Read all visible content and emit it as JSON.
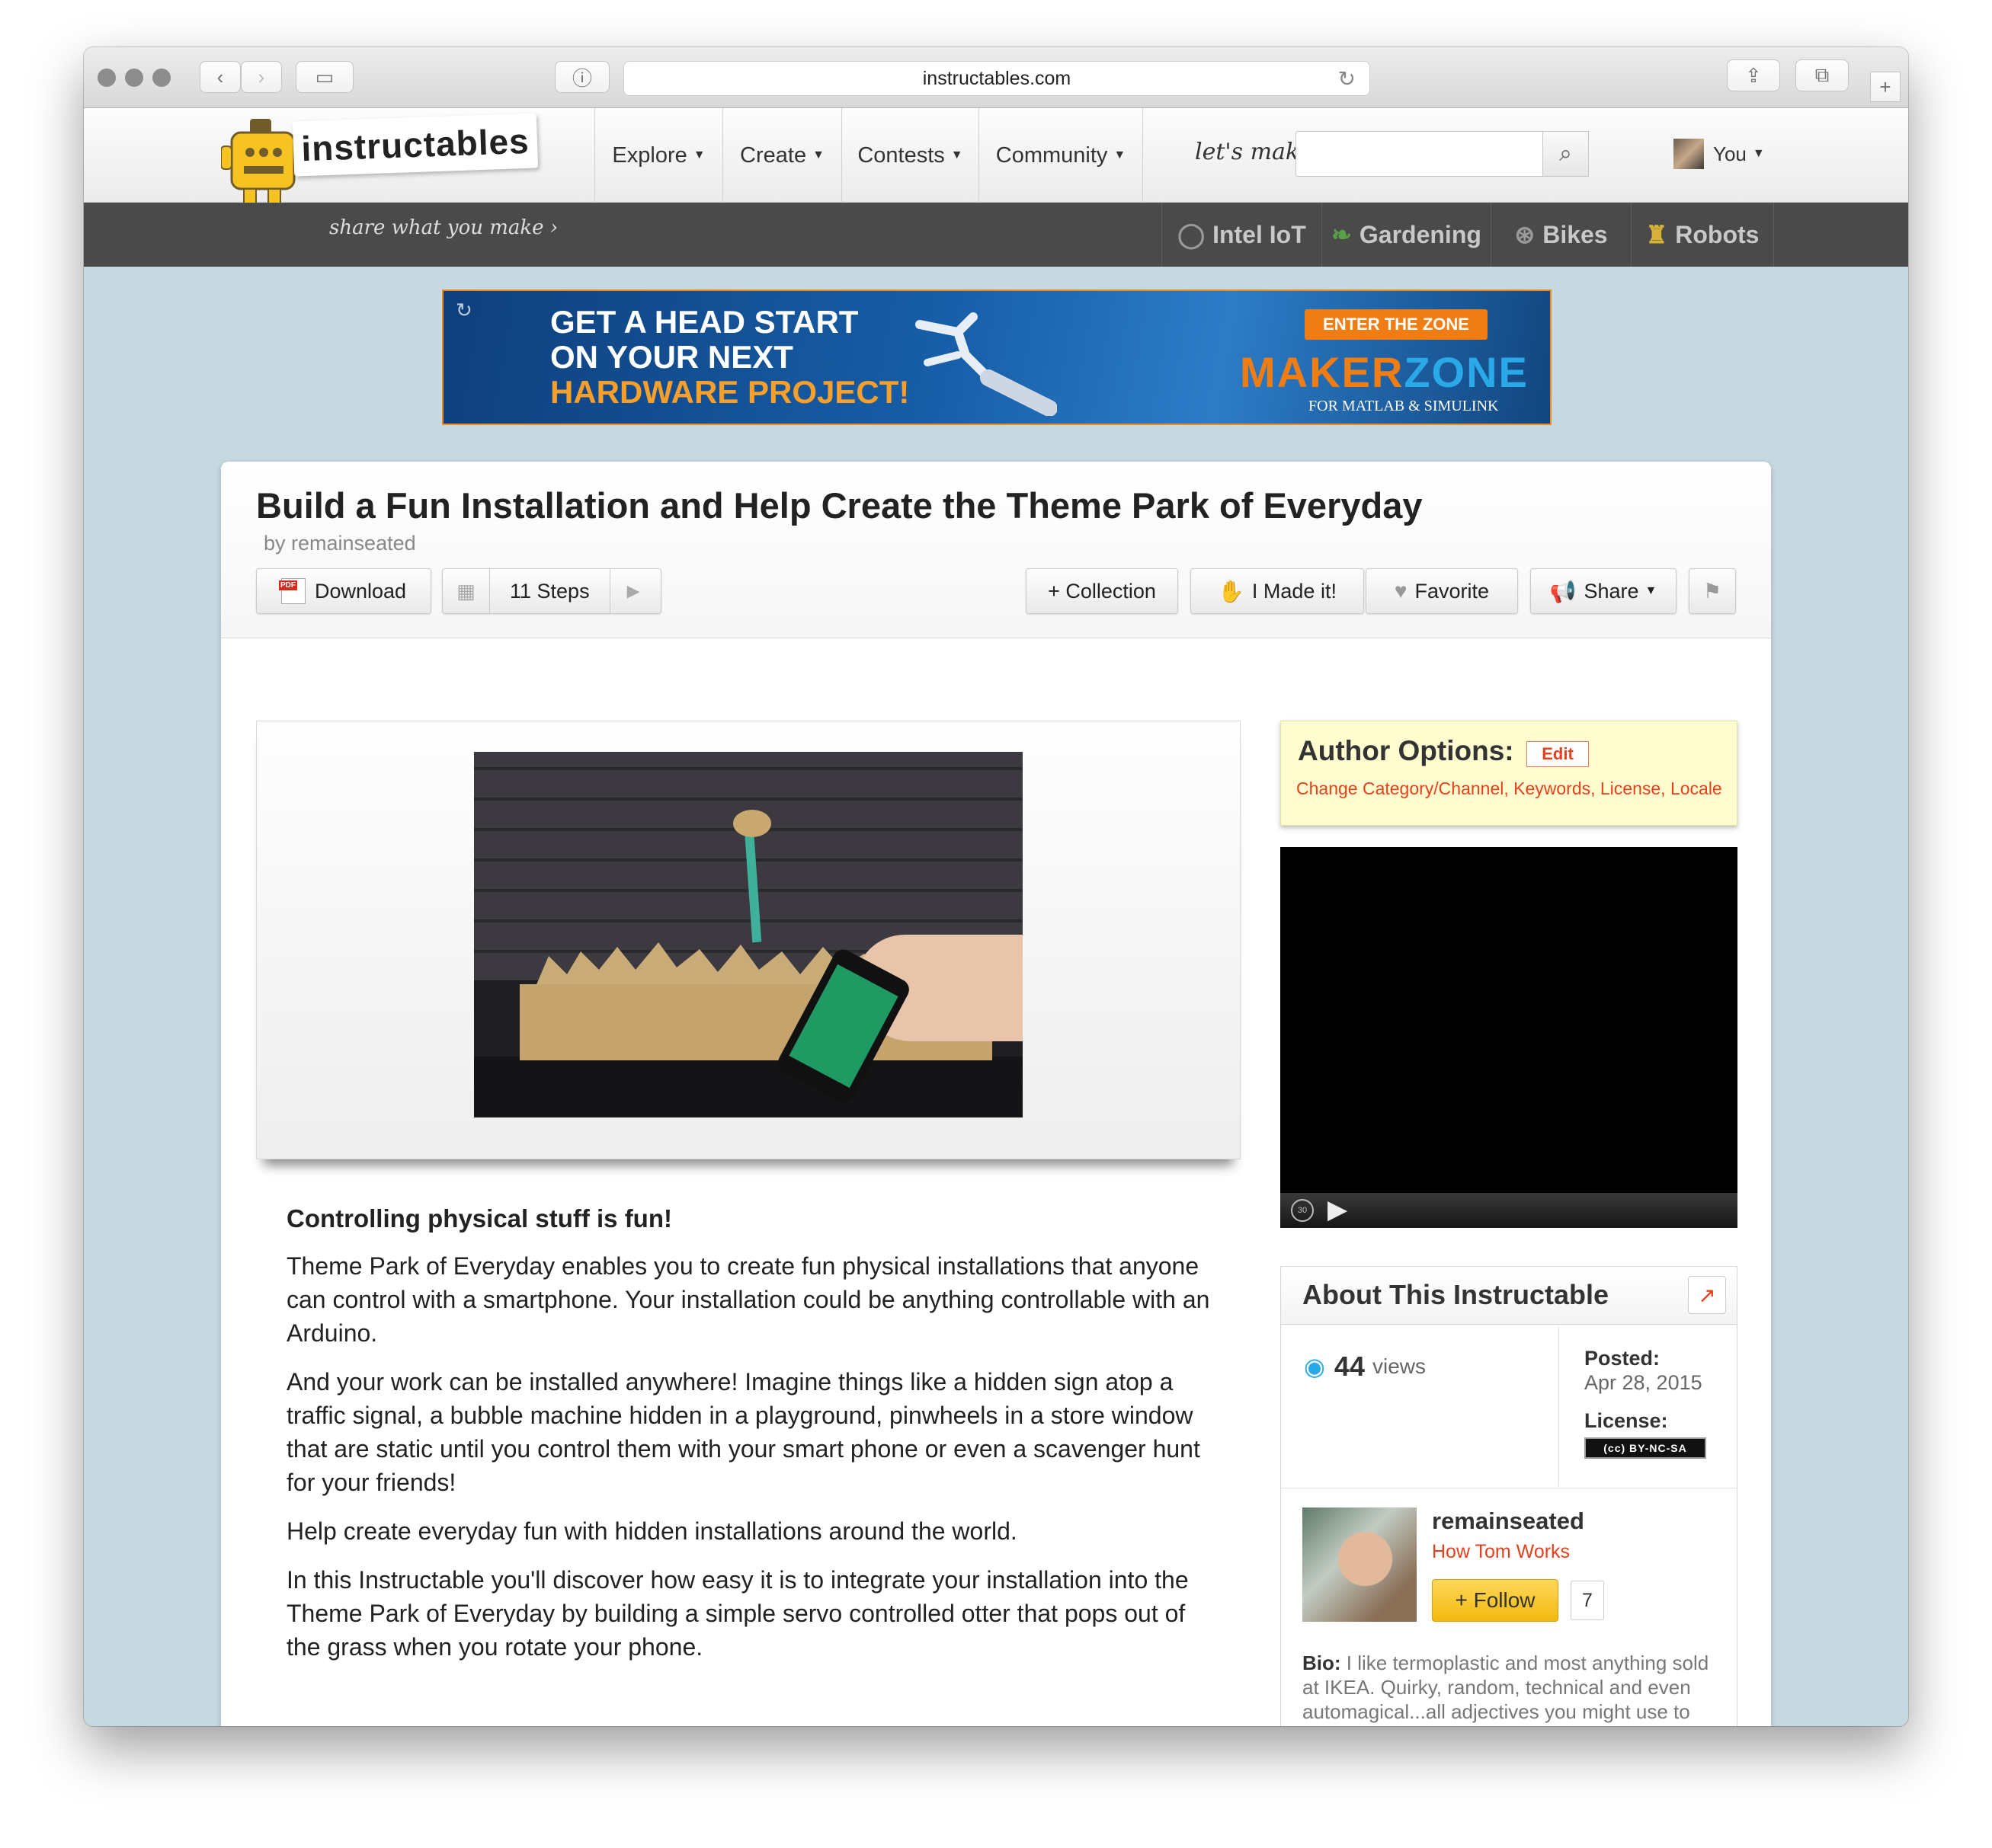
{
  "browser": {
    "url": "instructables.com"
  },
  "site": {
    "logo_text": "instructables",
    "tagline": "share what you make ›",
    "nav": [
      {
        "label": "Explore"
      },
      {
        "label": "Create"
      },
      {
        "label": "Contests"
      },
      {
        "label": "Community"
      }
    ],
    "search_label": "let's make",
    "search_placeholder": "",
    "user_label": "You",
    "channels": [
      {
        "label": "Intel IoT",
        "icon": "intel-icon"
      },
      {
        "label": "Gardening",
        "icon": "leaf-icon"
      },
      {
        "label": "Bikes",
        "icon": "wheel-icon"
      },
      {
        "label": "Robots",
        "icon": "robot-icon"
      }
    ]
  },
  "ad": {
    "line1": "GET A HEAD START",
    "line2": "ON YOUR NEXT",
    "line3": "HARDWARE PROJECT!",
    "cta": "ENTER THE ZONE",
    "brand_a": "MAKER",
    "brand_b": "ZONE",
    "brand_sub": "FOR MATLAB & SIMULINK"
  },
  "article": {
    "title": "Build a Fun Installation and Help Create the Theme Park of Everyday",
    "byline": "by remainseated",
    "buttons": {
      "download": "Download",
      "steps": "11 Steps",
      "collection": "+ Collection",
      "made_it": "I Made it!",
      "favorite": "Favorite",
      "share": "Share"
    },
    "heading": "Controlling physical stuff is fun!",
    "paragraphs": [
      "Theme Park of Everyday enables you to create fun physical installations that anyone can control with a smartphone. Your installation could be anything controllable with an Arduino.",
      "And your work can be installed anywhere! Imagine things like a hidden sign atop a traffic signal, a bubble machine hidden in a playground, pinwheels in a store window that are static until you control them with your smart phone or even a scavenger hunt for your friends!",
      "Help create everyday fun with hidden installations around the world.",
      "In this Instructable you'll discover how easy it is to integrate your installation into the Theme Park of Everyday by building a simple servo controlled otter that pops out of the grass when you rotate your phone."
    ]
  },
  "author_options": {
    "title": "Author Options:",
    "edit": "Edit",
    "links": "Change Category/Channel, Keywords, License, Locale"
  },
  "video": {
    "replay_label": "30"
  },
  "about": {
    "title": "About This Instructable",
    "views_count": "44",
    "views_label": "views",
    "posted_label": "Posted:",
    "posted_date": "Apr 28, 2015",
    "license_label": "License:",
    "license_badge": "(cc) BY-NC-SA",
    "author_name": "remainseated",
    "author_from": "How Tom Works",
    "follow_label": "+ Follow",
    "follow_count": "7",
    "bio_label": "Bio:",
    "bio_text": " I like termoplastic and most anything sold at IKEA. Quirky, random, technical and even automagical...all adjectives you might use to describe me! That's all I've got."
  },
  "colors": {
    "accent_orange": "#e7401d",
    "follow_yellow": "#f2b80e",
    "page_bg": "#c6d9e1"
  }
}
